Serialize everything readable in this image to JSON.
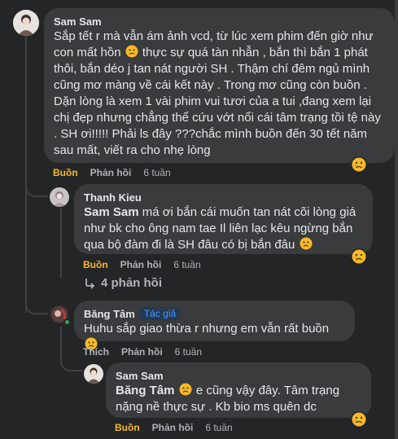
{
  "comments": [
    {
      "author": "Sam Sam",
      "text_part1": "Sắp tết r mà vẫn ám ảnh vcd, từ lúc xem phim đến giờ như con mất hồn ",
      "text_part2": " thực sự quá tàn nhẫn , bắn thì bắn 1 phát thôi, bắn déo j tan nát người SH . Thậm chí đêm ngủ mình cũng mơ màng về cái kết này . Trong mơ cũng còn buồn . Dặn lòng là xem 1 vài phim vui tươi của a tui ,đang xem lại chị đẹp nhưng chẳng thể cứu vớt nổi cái tâm trạng tồi tệ này . SH ơi!!!!! Phải ls đây ???chắc mình buồn đến 30 tết năm sau mất, viết ra cho nhẹ lòng",
      "like_label": "Buồn",
      "reply_label": "Phản hồi",
      "time": "6 tuần",
      "reaction_icon": "sad-face-icon"
    },
    {
      "author": "Thanh Kieu",
      "mention": "Sam Sam",
      "text": " má ơi bắn cái muốn tan nát cõi lòng giá như bk cho ông nam tae Il liên lạc kêu ngừng bắn qua bộ đàm đi là SH đâu có bị bắn đâu ",
      "like_label": "Buồn",
      "reply_label": "Phản hồi",
      "time": "6 tuần",
      "more_replies": "4 phản hồi"
    },
    {
      "author": "Băng Tâm",
      "badge": "Tác giả",
      "text": "Huhu sắp giao thừa r nhưng em vẫn rất buồn ",
      "like_label": "Thích",
      "reply_label": "Phản hồi",
      "time": "6 tuần"
    },
    {
      "author": "Sam Sam",
      "mention": "Băng Tâm",
      "text_part1": " ",
      "text_part2": " e cũng vậy đây. Tâm trạng nặng nề thực sự . Kb bio ms quên dc",
      "like_label": "Buồn",
      "reply_label": "Phản hồi",
      "time": "6 tuần"
    }
  ],
  "colors": {
    "background": "#242526",
    "bubble": "#3a3b3c",
    "sad_reaction": "#f7b928",
    "author_badge": "#4599ff"
  }
}
